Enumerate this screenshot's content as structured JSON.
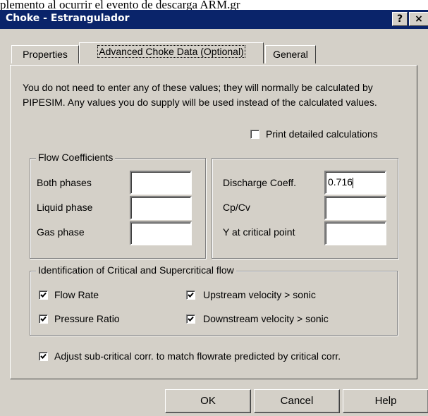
{
  "background_text": "plemento al ocurrir el evento de descarga ARM.gr",
  "window": {
    "title": "Choke - Estrangulador",
    "help_button": "?",
    "close_button": "×"
  },
  "tabs": [
    {
      "label": "Properties",
      "active": false
    },
    {
      "label": "Advanced Choke Data (Optional)",
      "active": true
    },
    {
      "label": "General",
      "active": false
    }
  ],
  "intro_text": "You do not need to enter any of these values; they will normally be calculated by PIPESIM. Any values you do supply will be used instead of the calculated values.",
  "print_detailed": {
    "label": "Print detailed calculations",
    "checked": false
  },
  "flow_coefficients": {
    "title": "Flow Coefficients",
    "both_phases": {
      "label": "Both phases",
      "value": ""
    },
    "liquid_phase": {
      "label": "Liquid phase",
      "value": ""
    },
    "gas_phase": {
      "label": "Gas phase",
      "value": ""
    }
  },
  "discharge": {
    "discharge_coeff": {
      "label": "Discharge Coeff.",
      "value": "0.716"
    },
    "cp_cv": {
      "label": "Cp/Cv",
      "value": ""
    },
    "y_critical": {
      "label": "Y at critical point",
      "value": ""
    }
  },
  "critical_flow": {
    "title": "Identification of Critical and Supercritical flow",
    "flow_rate": {
      "label": "Flow Rate",
      "checked": true
    },
    "pressure_ratio": {
      "label": "Pressure Ratio",
      "checked": true
    },
    "upstream": {
      "label": "Upstream velocity > sonic",
      "checked": true
    },
    "downstream": {
      "label": "Downstream velocity > sonic",
      "checked": true
    }
  },
  "adjust_subcritical": {
    "label": "Adjust sub-critical corr. to match flowrate predicted by critical corr.",
    "checked": true
  },
  "buttons": {
    "ok": "OK",
    "cancel": "Cancel",
    "help": "Help"
  }
}
